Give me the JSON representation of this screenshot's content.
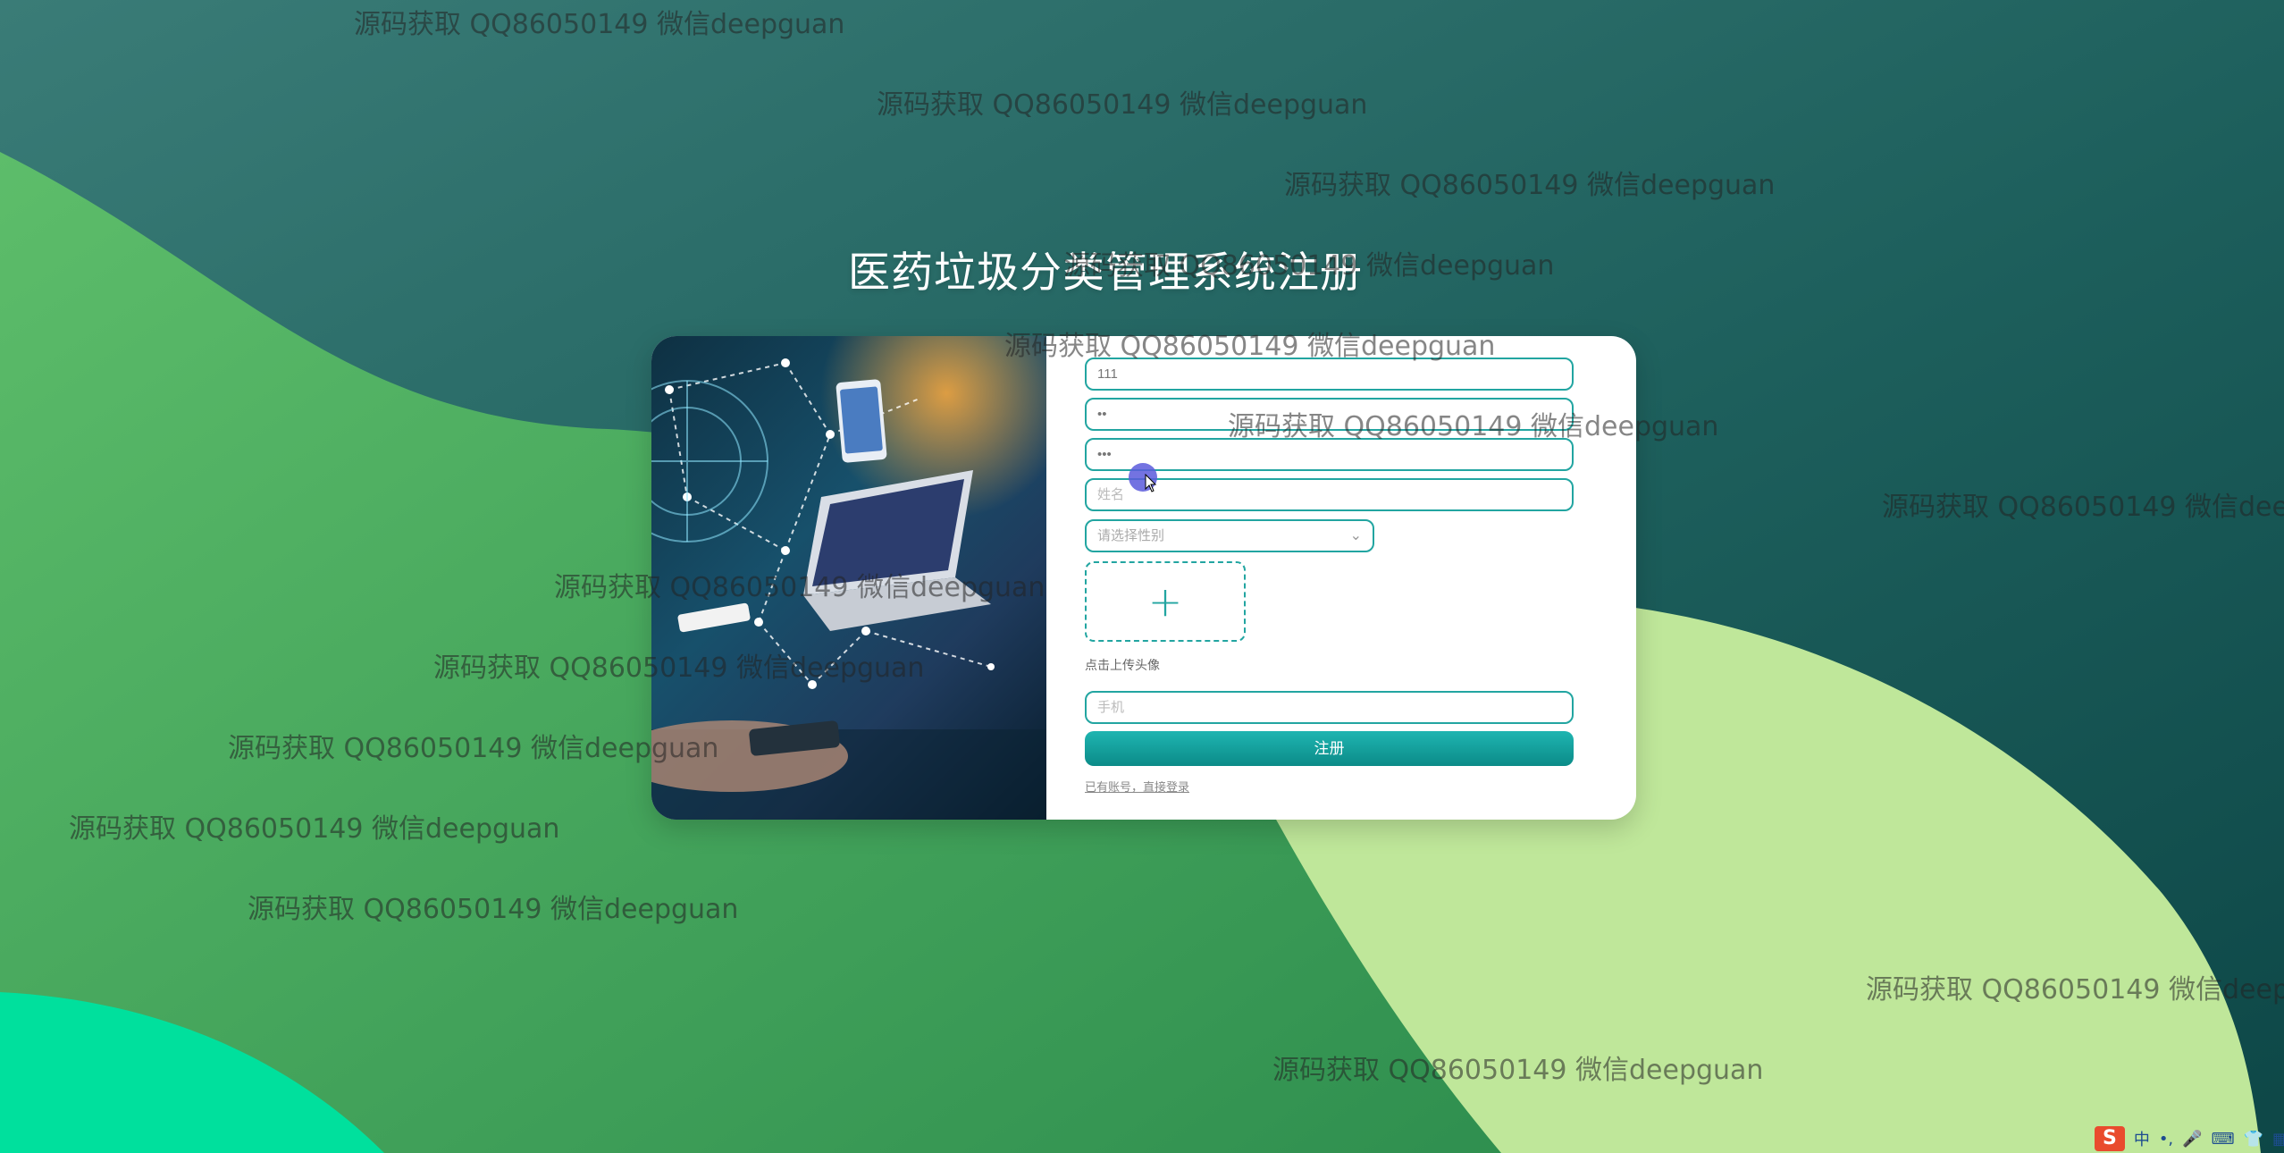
{
  "page": {
    "title": "医药垃圾分类管理系统注册"
  },
  "form": {
    "account_value": "111",
    "password_value": "••",
    "confirm_password_value": "•••",
    "name_placeholder": "姓名",
    "gender_placeholder": "请选择性别",
    "upload_hint": "点击上传头像",
    "phone_placeholder": "手机",
    "register_label": "注册",
    "login_link": "已有账号，直接登录"
  },
  "watermark": {
    "text": "源码获取 QQ86050149 微信deepguan"
  },
  "tray": {
    "ime_label": "中",
    "punct_label": "•,",
    "mic_icon": "microphone-icon",
    "keyboard_icon": "keyboard-icon",
    "skin_icon": "shirt-icon",
    "grid_icon": "grid-icon"
  },
  "colors": {
    "accent": "#22a5a1",
    "button": "#0b8b88",
    "bg_dark": "#1e6a63",
    "bg_green": "#3f9d55",
    "bg_light": "#bfe79a",
    "bg_mint": "#00e09d"
  }
}
